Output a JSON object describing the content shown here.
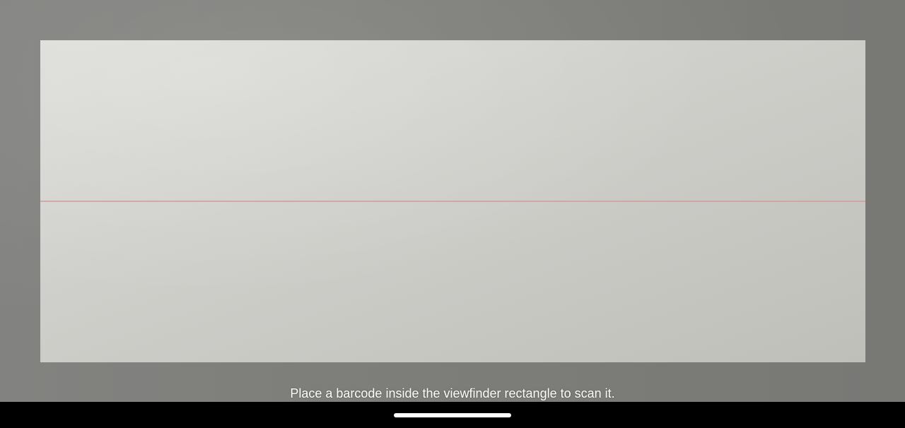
{
  "scanner": {
    "instruction": "Place a barcode inside the viewfinder rectangle to scan it.",
    "laser_color": "#d89a9a"
  },
  "navigation": {
    "gesture_handle": "home-handle"
  }
}
